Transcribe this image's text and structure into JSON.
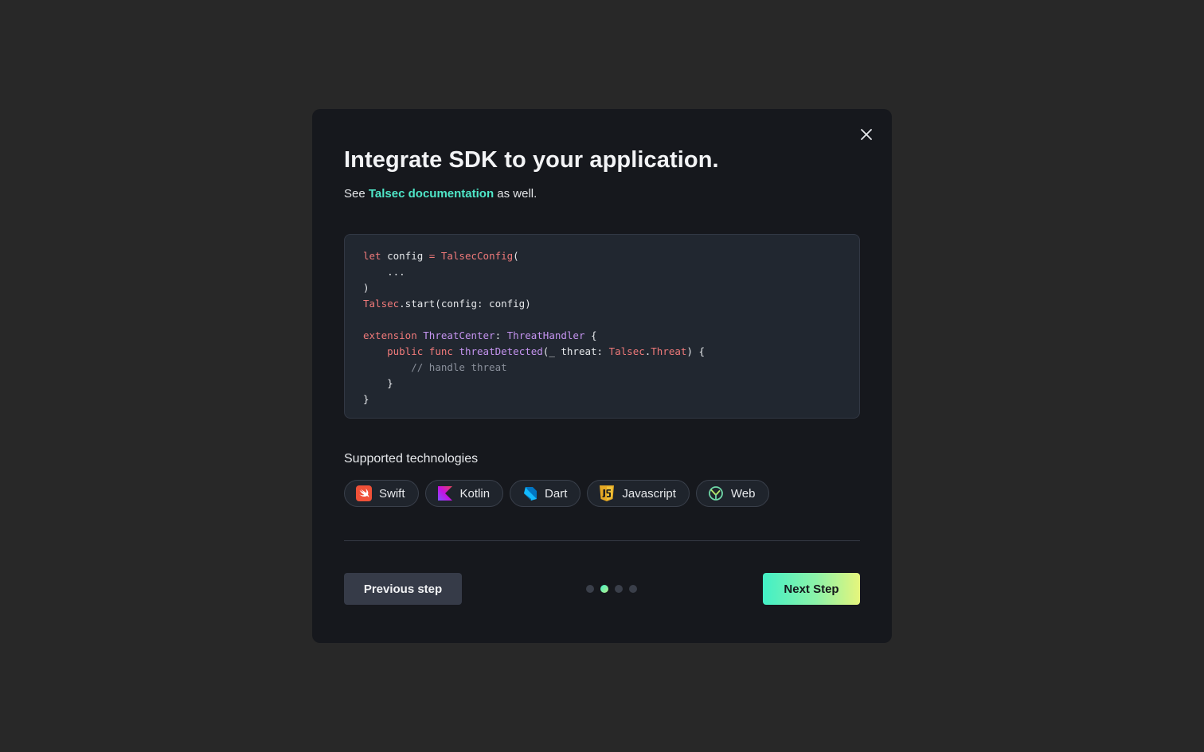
{
  "modal": {
    "title": "Integrate SDK to your application.",
    "subtitle_prefix": "See ",
    "subtitle_link": "Talsec documentation",
    "subtitle_suffix": " as well.",
    "close_icon": "close-icon"
  },
  "code": {
    "lines": [
      [
        {
          "t": "let",
          "c": "kw"
        },
        {
          "t": " config "
        },
        {
          "t": "=",
          "c": "kw"
        },
        {
          "t": " "
        },
        {
          "t": "TalsecConfig",
          "c": "kw"
        },
        {
          "t": "("
        }
      ],
      [
        {
          "t": "    ..."
        }
      ],
      [
        {
          "t": ")"
        }
      ],
      [
        {
          "t": "Talsec",
          "c": "kw"
        },
        {
          "t": ".start(config: config)"
        }
      ],
      [],
      [
        {
          "t": "extension",
          "c": "kw"
        },
        {
          "t": " "
        },
        {
          "t": "ThreatCenter",
          "c": "ty"
        },
        {
          "t": ": "
        },
        {
          "t": "ThreatHandler",
          "c": "ty"
        },
        {
          "t": " {"
        }
      ],
      [
        {
          "t": "    "
        },
        {
          "t": "public",
          "c": "kw"
        },
        {
          "t": " "
        },
        {
          "t": "func",
          "c": "kw"
        },
        {
          "t": " "
        },
        {
          "t": "threatDetected",
          "c": "ty"
        },
        {
          "t": "(_ threat: "
        },
        {
          "t": "Talsec",
          "c": "kw"
        },
        {
          "t": "."
        },
        {
          "t": "Threat",
          "c": "kw"
        },
        {
          "t": ") {"
        }
      ],
      [
        {
          "t": "        "
        },
        {
          "t": "// handle threat",
          "c": "cm"
        }
      ],
      [
        {
          "t": "    }"
        }
      ],
      [
        {
          "t": "}"
        }
      ]
    ]
  },
  "technologies": {
    "label": "Supported technologies",
    "items": [
      {
        "label": "Swift",
        "icon": "swift-icon"
      },
      {
        "label": "Kotlin",
        "icon": "kotlin-icon"
      },
      {
        "label": "Dart",
        "icon": "dart-icon"
      },
      {
        "label": "Javascript",
        "icon": "javascript-icon"
      },
      {
        "label": "Web",
        "icon": "web-icon"
      }
    ]
  },
  "footer": {
    "prev_label": "Previous step",
    "next_label": "Next Step",
    "steps_total": 4,
    "current_step": 2
  },
  "colors": {
    "accent": "#4fe6c8",
    "keyword": "#f07a7a",
    "type": "#c594f0"
  }
}
